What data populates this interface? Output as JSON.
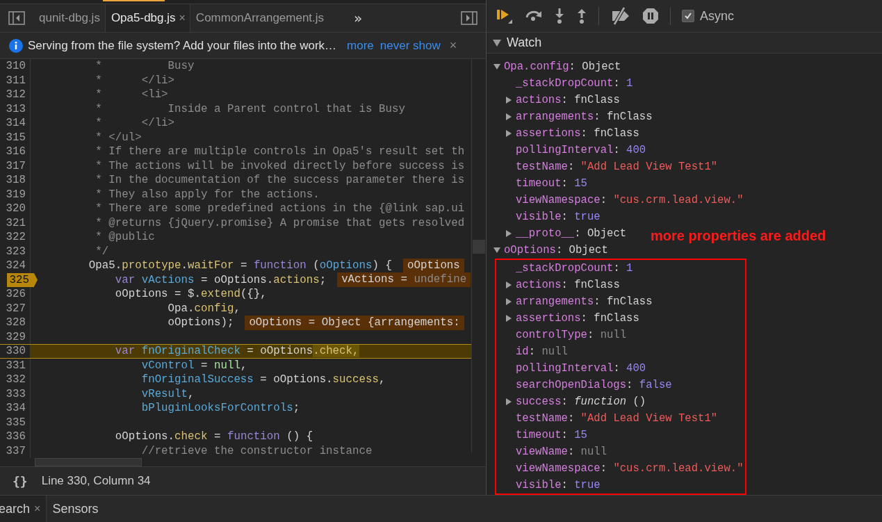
{
  "editor": {
    "tabs": [
      {
        "label": "qunit-dbg.js",
        "selected": false
      },
      {
        "label": "Opa5-dbg.js",
        "selected": true,
        "close": "×"
      },
      {
        "label": "CommonArrangement.js",
        "selected": false
      }
    ],
    "more_tabs": "»",
    "infobar": {
      "message": "Serving from the file system? Add your files into the work…",
      "links": [
        "more",
        "never show"
      ],
      "close": "×"
    },
    "lines": [
      {
        "num": "310",
        "breakpoint": false,
        "current": false,
        "tokens": [
          {
            "text": "         *          Busy",
            "kind": "comment"
          }
        ]
      },
      {
        "num": "311",
        "breakpoint": false,
        "current": false,
        "tokens": [
          {
            "text": "         *      </li>",
            "kind": "comment"
          }
        ]
      },
      {
        "num": "312",
        "breakpoint": false,
        "current": false,
        "tokens": [
          {
            "text": "         *      <li>",
            "kind": "comment"
          }
        ]
      },
      {
        "num": "313",
        "breakpoint": false,
        "current": false,
        "tokens": [
          {
            "text": "         *          Inside a Parent control that is Busy",
            "kind": "comment"
          }
        ]
      },
      {
        "num": "314",
        "breakpoint": false,
        "current": false,
        "tokens": [
          {
            "text": "         *      </li>",
            "kind": "comment"
          }
        ]
      },
      {
        "num": "315",
        "breakpoint": false,
        "current": false,
        "tokens": [
          {
            "text": "         * </ul>",
            "kind": "comment"
          }
        ]
      },
      {
        "num": "316",
        "breakpoint": false,
        "current": false,
        "tokens": [
          {
            "text": "         * If there are multiple controls in Opa5's result set th",
            "kind": "comment"
          }
        ]
      },
      {
        "num": "317",
        "breakpoint": false,
        "current": false,
        "tokens": [
          {
            "text": "         * The actions will be invoked directly before success is",
            "kind": "comment"
          }
        ]
      },
      {
        "num": "318",
        "breakpoint": false,
        "current": false,
        "tokens": [
          {
            "text": "         * In the documentation of the success parameter there is",
            "kind": "comment"
          }
        ]
      },
      {
        "num": "319",
        "breakpoint": false,
        "current": false,
        "tokens": [
          {
            "text": "         * They also apply for the actions.",
            "kind": "comment"
          }
        ]
      },
      {
        "num": "320",
        "breakpoint": false,
        "current": false,
        "tokens": [
          {
            "text": "         * There are some predefined actions in the {@link sap.ui",
            "kind": "comment"
          }
        ]
      },
      {
        "num": "321",
        "breakpoint": false,
        "current": false,
        "tokens": [
          {
            "text": "         * @returns {jQuery.promise} A promise that gets resolved",
            "kind": "comment"
          }
        ]
      },
      {
        "num": "322",
        "breakpoint": false,
        "current": false,
        "tokens": [
          {
            "text": "         * @public",
            "kind": "comment"
          }
        ]
      },
      {
        "num": "323",
        "breakpoint": false,
        "current": false,
        "tokens": [
          {
            "text": "         */",
            "kind": "comment"
          }
        ]
      },
      {
        "num": "324",
        "breakpoint": false,
        "current": false,
        "tokens": [
          {
            "text": "        Opa5.",
            "kind": "plain"
          },
          {
            "text": "prototype",
            "kind": "property"
          },
          {
            "text": ".",
            "kind": "plain"
          },
          {
            "text": "waitFor",
            "kind": "property"
          },
          {
            "text": " = ",
            "kind": "plain"
          },
          {
            "text": "function",
            "kind": "keyword"
          },
          {
            "text": " (",
            "kind": "plain"
          },
          {
            "text": "oOptions",
            "kind": "variable"
          },
          {
            "text": ") {",
            "kind": "plain"
          }
        ],
        "inline": [
          {
            "text": "oOptions",
            "kind": "plain"
          }
        ]
      },
      {
        "num": "325",
        "breakpoint": true,
        "current": false,
        "tokens": [
          {
            "text": "            var",
            "kind": "keyword"
          },
          {
            "text": " vActions",
            "kind": "variable"
          },
          {
            "text": " = oOptions.",
            "kind": "plain"
          },
          {
            "text": "actions",
            "kind": "property"
          },
          {
            "text": ";",
            "kind": "plain"
          }
        ],
        "inline": [
          {
            "text": "vActions = ",
            "kind": "plain"
          },
          {
            "text": "undefine",
            "kind": "comment"
          }
        ]
      },
      {
        "num": "326",
        "breakpoint": false,
        "current": false,
        "tokens": [
          {
            "text": "            oOptions = $.",
            "kind": "plain"
          },
          {
            "text": "extend",
            "kind": "property"
          },
          {
            "text": "({},",
            "kind": "plain"
          }
        ]
      },
      {
        "num": "327",
        "breakpoint": false,
        "current": false,
        "tokens": [
          {
            "text": "                    Opa.",
            "kind": "plain"
          },
          {
            "text": "config",
            "kind": "property"
          },
          {
            "text": ",",
            "kind": "plain"
          }
        ]
      },
      {
        "num": "328",
        "breakpoint": false,
        "current": false,
        "tokens": [
          {
            "text": "                    oOptions);",
            "kind": "plain"
          }
        ],
        "inline": [
          {
            "text": "oOptions = Object {arrangements:",
            "kind": "plain"
          }
        ]
      },
      {
        "num": "329",
        "breakpoint": false,
        "current": false
      },
      {
        "num": "330",
        "breakpoint": false,
        "current": true,
        "tokens": [
          {
            "text": "            var",
            "kind": "keyword"
          },
          {
            "text": " fnOriginalCheck",
            "kind": "variable"
          },
          {
            "text": " = oOptions",
            "kind": "plain"
          },
          {
            "text": ".check,",
            "kind": "property",
            "highlighted": true
          }
        ]
      },
      {
        "num": "331",
        "breakpoint": false,
        "current": false,
        "tokens": [
          {
            "text": "                vControl",
            "kind": "variable"
          },
          {
            "text": " = ",
            "kind": "plain"
          },
          {
            "text": "null",
            "kind": "literal"
          },
          {
            "text": ",",
            "kind": "plain"
          }
        ]
      },
      {
        "num": "332",
        "breakpoint": false,
        "current": false,
        "tokens": [
          {
            "text": "                fnOriginalSuccess",
            "kind": "variable"
          },
          {
            "text": " = oOptions.",
            "kind": "plain"
          },
          {
            "text": "success",
            "kind": "property"
          },
          {
            "text": ",",
            "kind": "plain"
          }
        ]
      },
      {
        "num": "333",
        "breakpoint": false,
        "current": false,
        "tokens": [
          {
            "text": "                vResult",
            "kind": "variable"
          },
          {
            "text": ",",
            "kind": "plain"
          }
        ]
      },
      {
        "num": "334",
        "breakpoint": false,
        "current": false,
        "tokens": [
          {
            "text": "                bPluginLooksForControls",
            "kind": "variable"
          },
          {
            "text": ";",
            "kind": "plain"
          }
        ]
      },
      {
        "num": "335",
        "breakpoint": false,
        "current": false
      },
      {
        "num": "336",
        "breakpoint": false,
        "current": false,
        "tokens": [
          {
            "text": "            oOptions.",
            "kind": "plain"
          },
          {
            "text": "check",
            "kind": "property"
          },
          {
            "text": " = ",
            "kind": "plain"
          },
          {
            "text": "function",
            "kind": "keyword"
          },
          {
            "text": " () {",
            "kind": "plain"
          }
        ]
      },
      {
        "num": "337",
        "breakpoint": false,
        "current": false,
        "tokens": [
          {
            "text": "                //retrieve the constructor instance",
            "kind": "comment"
          }
        ]
      }
    ],
    "status": {
      "format": "{}",
      "position": "Line 330, Column 34"
    }
  },
  "debugger": {
    "async": {
      "label": "Async",
      "checked": true
    },
    "watch": {
      "title": "Watch",
      "expanded": true,
      "nodes": [
        {
          "name": "Opa.config",
          "sep": ":",
          "value": "Object",
          "kind": "object",
          "expanded": true,
          "framed": false,
          "children": [
            {
              "name": "_stackDropCount",
              "sep": ":",
              "value": "1",
              "kind": "number"
            },
            {
              "name": "actions",
              "sep": ":",
              "value": "fnClass",
              "kind": "object",
              "expanded": false
            },
            {
              "name": "arrangements",
              "sep": ":",
              "value": "fnClass",
              "kind": "object",
              "expanded": false
            },
            {
              "name": "assertions",
              "sep": ":",
              "value": "fnClass",
              "kind": "object",
              "expanded": false
            },
            {
              "name": "pollingInterval",
              "sep": ":",
              "value": "400",
              "kind": "number"
            },
            {
              "name": "testName",
              "sep": ":",
              "value": "\"Add Lead View Test1\"",
              "kind": "string"
            },
            {
              "name": "timeout",
              "sep": ":",
              "value": "15",
              "kind": "number"
            },
            {
              "name": "viewNamespace",
              "sep": ":",
              "value": "\"cus.crm.lead.view.\"",
              "kind": "string"
            },
            {
              "name": "visible",
              "sep": ":",
              "value": "true",
              "kind": "boolean"
            },
            {
              "name": "__proto__",
              "sep": ":",
              "value": "Object",
              "kind": "object",
              "expanded": false
            }
          ]
        },
        {
          "name": "oOptions",
          "sep": ":",
          "value": "Object",
          "kind": "object",
          "expanded": true,
          "framed": true,
          "children": [
            {
              "name": "_stackDropCount",
              "sep": ":",
              "value": "1",
              "kind": "number"
            },
            {
              "name": "actions",
              "sep": ":",
              "value": "fnClass",
              "kind": "object",
              "expanded": false
            },
            {
              "name": "arrangements",
              "sep": ":",
              "value": "fnClass",
              "kind": "object",
              "expanded": false
            },
            {
              "name": "assertions",
              "sep": ":",
              "value": "fnClass",
              "kind": "object",
              "expanded": false
            },
            {
              "name": "controlType",
              "sep": ":",
              "value": "null",
              "kind": "null"
            },
            {
              "name": "id",
              "sep": ":",
              "value": "null",
              "kind": "null"
            },
            {
              "name": "pollingInterval",
              "sep": ":",
              "value": "400",
              "kind": "number"
            },
            {
              "name": "searchOpenDialogs",
              "sep": ":",
              "value": "false",
              "kind": "boolean"
            },
            {
              "name": "success",
              "sep": ":",
              "value": "*function* ()",
              "kind": "function",
              "expanded": false
            },
            {
              "name": "testName",
              "sep": ":",
              "value": "\"Add Lead View Test1\"",
              "kind": "string"
            },
            {
              "name": "timeout",
              "sep": ":",
              "value": "15",
              "kind": "number"
            },
            {
              "name": "viewName",
              "sep": ":",
              "value": "null",
              "kind": "null"
            },
            {
              "name": "viewNamespace",
              "sep": ":",
              "value": "\"cus.crm.lead.view.\"",
              "kind": "string"
            },
            {
              "name": "visible",
              "sep": ":",
              "value": "true",
              "kind": "boolean"
            }
          ]
        }
      ]
    },
    "annotation": "more properties are added"
  },
  "drawer_tabs": [
    {
      "label": "earch",
      "selected": true,
      "close": "×"
    },
    {
      "label": "Sensors",
      "selected": false
    }
  ]
}
